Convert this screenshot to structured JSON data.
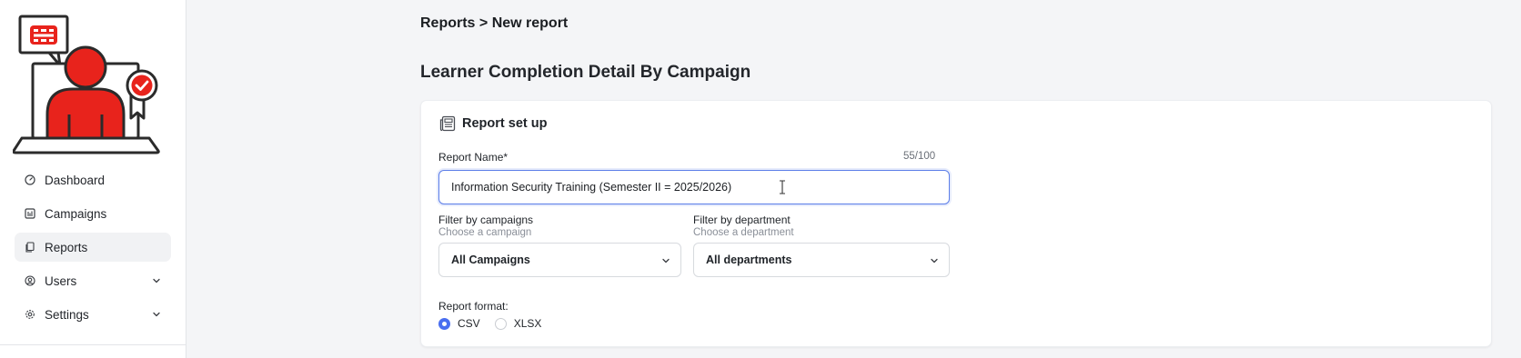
{
  "colors": {
    "brand_red": "#e8231c",
    "accent_blue": "#4a6ff0",
    "sidebar_active_bg": "#f1f2f4"
  },
  "sidebar": {
    "logo_icon": "learner-shield-logo",
    "items": [
      {
        "label": "Dashboard",
        "icon": "gauge-icon",
        "active": false,
        "expandable": false
      },
      {
        "label": "Campaigns",
        "icon": "chart-bars-icon",
        "active": false,
        "expandable": false
      },
      {
        "label": "Reports",
        "icon": "documents-icon",
        "active": true,
        "expandable": false
      },
      {
        "label": "Users",
        "icon": "user-circle-icon",
        "active": false,
        "expandable": true
      },
      {
        "label": "Settings",
        "icon": "gear-icon",
        "active": false,
        "expandable": true
      }
    ]
  },
  "breadcrumb": "Reports > New report",
  "page_title": "Learner Completion Detail By Campaign",
  "card": {
    "title": "Report set up",
    "icon": "newspaper-icon",
    "report_name": {
      "label": "Report Name*",
      "value": "Information Security Training (Semester II = 2025/2026)",
      "counter": "55/100"
    },
    "filter_campaigns": {
      "label": "Filter by campaigns",
      "hint": "Choose a campaign",
      "selected": "All Campaigns"
    },
    "filter_department": {
      "label": "Filter by department",
      "hint": "Choose a department",
      "selected": "All departments"
    },
    "format": {
      "label": "Report format:",
      "options": [
        {
          "label": "CSV",
          "checked": true
        },
        {
          "label": "XLSX",
          "checked": false
        }
      ]
    }
  }
}
